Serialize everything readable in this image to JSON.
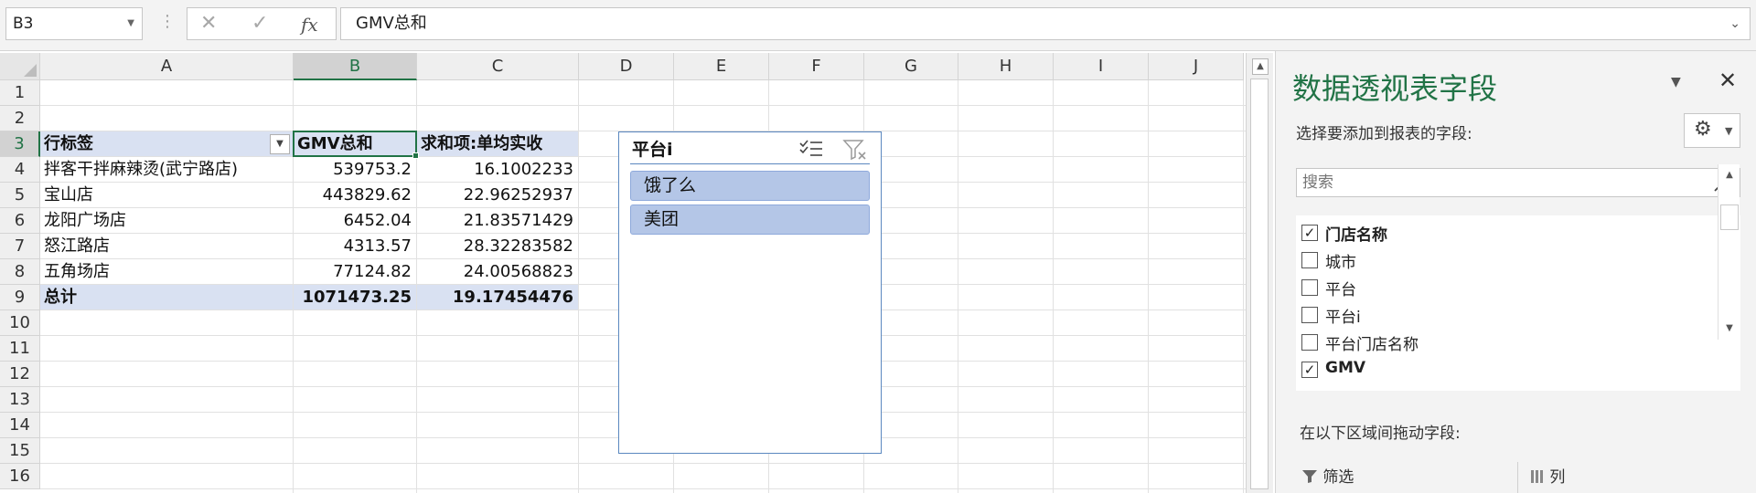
{
  "name_box": "B3",
  "formula_bar": {
    "cancel_icon": "✕",
    "enter_icon": "✓",
    "fx_label": "fx",
    "formula": "GMV总和"
  },
  "columns": [
    "A",
    "B",
    "C",
    "D",
    "E",
    "F",
    "G",
    "H",
    "I",
    "J"
  ],
  "rows": [
    "1",
    "2",
    "3",
    "4",
    "5",
    "6",
    "7",
    "8",
    "9",
    "10",
    "11",
    "12",
    "13",
    "14",
    "15",
    "16"
  ],
  "pivot": {
    "headers": [
      "行标签",
      "GMV总和",
      "求和项:单均实收"
    ],
    "rows": [
      {
        "label": "拌客干拌麻辣烫(武宁路店)",
        "gmv": "539753.2",
        "avg": "16.1002233"
      },
      {
        "label": "宝山店",
        "gmv": "443829.62",
        "avg": "22.96252937"
      },
      {
        "label": "龙阳广场店",
        "gmv": "6452.04",
        "avg": "21.83571429"
      },
      {
        "label": "怒江路店",
        "gmv": "4313.57",
        "avg": "28.32283582"
      },
      {
        "label": "五角场店",
        "gmv": "77124.82",
        "avg": "24.00568823"
      }
    ],
    "total": {
      "label": "总计",
      "gmv": "1071473.25",
      "avg": "19.17454476"
    }
  },
  "slicer": {
    "title": "平台i",
    "items": [
      "饿了么",
      "美团"
    ]
  },
  "pane": {
    "title": "数据透视表字段",
    "choose_label": "选择要添加到报表的字段:",
    "search_placeholder": "搜索",
    "fields": [
      {
        "label": "门店名称",
        "checked": true
      },
      {
        "label": "城市",
        "checked": false
      },
      {
        "label": "平台",
        "checked": false
      },
      {
        "label": "平台i",
        "checked": false
      },
      {
        "label": "平台门店名称",
        "checked": false
      },
      {
        "label": "GMV",
        "checked": true
      }
    ],
    "drag_label": "在以下区域间拖动字段:",
    "filter_area": "筛选",
    "columns_area": "列"
  },
  "colors": {
    "accent": "#217346",
    "band": "#d9e1f2",
    "slicer_item": "#b4c6e7"
  }
}
